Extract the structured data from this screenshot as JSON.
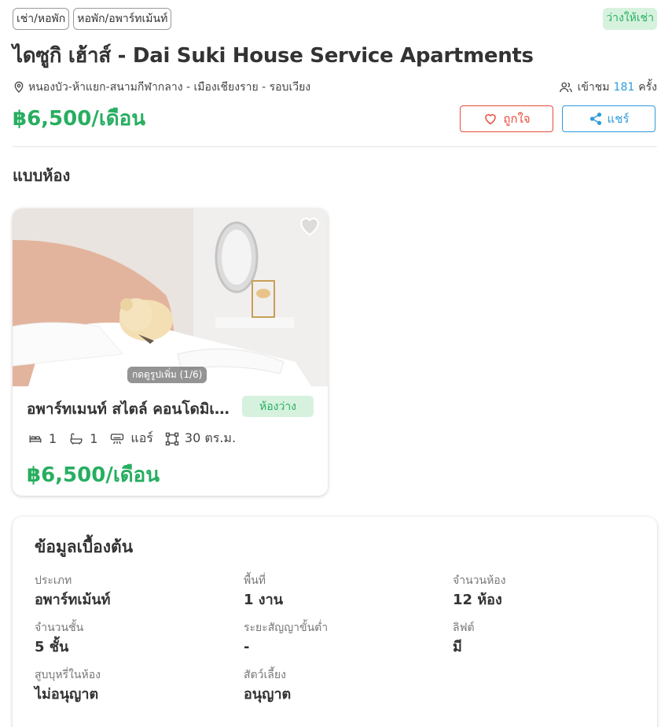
{
  "tags": [
    "เช่า/หอพัก",
    "หอพัก/อพาร์ทเม้นท์"
  ],
  "availability": "ว่างให้เช่า",
  "title": "ไดซูกิ เฮ้าส์ - Dai Suki House Service Apartments",
  "location": "หนองบัว-ห้าแยก-สนามกีฬากลาง - เมืองเชียงราย - รอบเวียง",
  "views": {
    "prefix": "เข้าชม",
    "count": "181",
    "suffix": "ครั้ง"
  },
  "price": "฿6,500/เดือน",
  "buttons": {
    "like": "ถูกใจ",
    "share": "แชร์"
  },
  "section_title": "แบบห้อง",
  "room": {
    "photo_caption": "กดดูรูปเพิ่ม (1/6)",
    "name": "อพาร์ทเมนท์ สไตล์ คอนโดมิเนียม",
    "status": "ห้องว่าง",
    "bedrooms": "1",
    "bathrooms": "1",
    "aircon": "แอร์",
    "size": "30 ตร.ม.",
    "price": "฿6,500/เดือน"
  },
  "info": {
    "title": "ข้อมูลเบื้องต้น",
    "fields": [
      {
        "label": "ประเภท",
        "value": "อพาร์ทเม้นท์"
      },
      {
        "label": "พื้นที่",
        "value": "1 งาน"
      },
      {
        "label": "จำนวนห้อง",
        "value": "12 ห้อง"
      },
      {
        "label": "จำนวนชั้น",
        "value": "5 ชั้น"
      },
      {
        "label": "ระยะสัญญาขั้นต่ำ",
        "value": "-"
      },
      {
        "label": "ลิฟต์",
        "value": "มี"
      },
      {
        "label": "สูบบุหรี่ในห้อง",
        "value": "ไม่อนุญาต"
      },
      {
        "label": "สัตว์เลี้ยง",
        "value": "อนุญาต"
      }
    ]
  },
  "colors": {
    "accent_green": "#27ae60",
    "accent_blue": "#2d9cdb",
    "like_red": "#e74c3c",
    "badge_green_bg": "#d6f2de"
  },
  "icons": [
    "location-pin-icon",
    "users-icon",
    "heart-icon",
    "share-icon",
    "bed-icon",
    "bath-icon",
    "air-conditioner-icon",
    "area-icon"
  ]
}
